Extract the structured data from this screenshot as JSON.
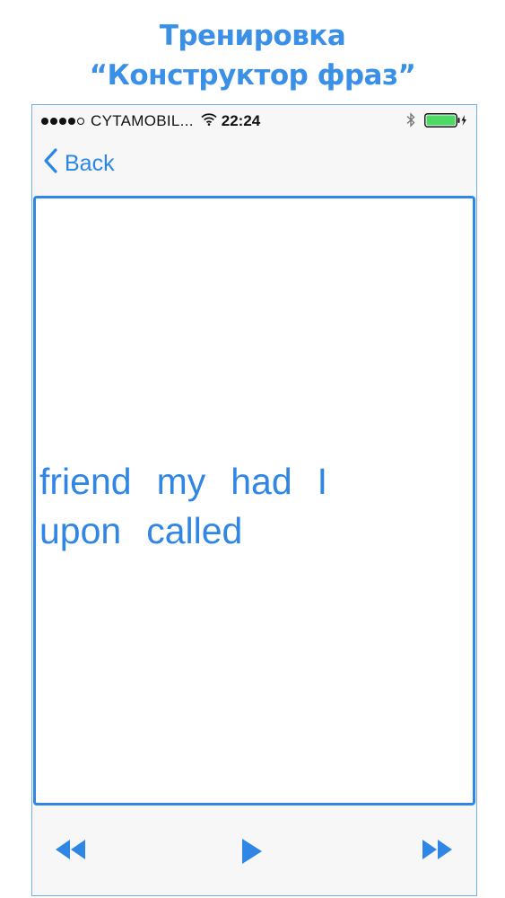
{
  "promo": {
    "title_line1": "Тренировка",
    "title_line2": "“Конструктор фраз”"
  },
  "status_bar": {
    "carrier": "CYTAMOBIL...",
    "time": "22:24",
    "signal_bars_filled": 4,
    "signal_bars_total": 5,
    "battery_level": 1.0
  },
  "nav": {
    "back_label": "Back"
  },
  "phrase": {
    "words": [
      "friend",
      "my",
      "had",
      "I",
      "upon",
      "called"
    ]
  },
  "toolbar": {
    "buttons": [
      "rewind-icon",
      "play-icon",
      "fast-forward-icon"
    ]
  },
  "colors": {
    "accent": "#2f86e5",
    "title": "#3a8fe6",
    "battery": "#4cd964"
  }
}
